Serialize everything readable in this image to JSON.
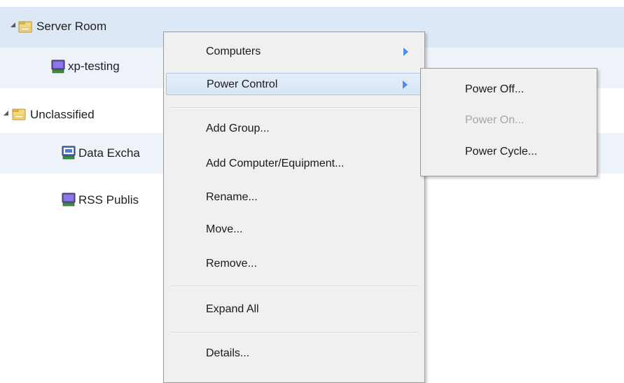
{
  "tree": {
    "nodes": [
      {
        "label": "Server Room",
        "icon": "folder-icon",
        "expanded": true
      },
      {
        "label": "xp-testing",
        "icon": "computer-icon"
      },
      {
        "label": "Unclassified",
        "icon": "folder-icon",
        "expanded": true
      },
      {
        "label": "Data Excha",
        "icon": "computer-icon"
      },
      {
        "label": "RSS Publis",
        "icon": "computer-icon"
      }
    ]
  },
  "context_menu": {
    "items": [
      {
        "label": "Computers",
        "has_submenu": true
      },
      {
        "label": "Power Control",
        "has_submenu": true,
        "highlighted": true
      },
      {
        "label": "Add Group..."
      },
      {
        "label": "Add Computer/Equipment..."
      },
      {
        "label": "Rename..."
      },
      {
        "label": "Move..."
      },
      {
        "label": "Remove..."
      },
      {
        "label": "Expand All"
      },
      {
        "label": "Details..."
      }
    ]
  },
  "power_submenu": {
    "items": [
      {
        "label": "Power Off...",
        "enabled": true
      },
      {
        "label": "Power On...",
        "enabled": false
      },
      {
        "label": "Power Cycle...",
        "enabled": true
      }
    ]
  },
  "colors": {
    "menu_background": "#f0f0f0",
    "highlight": "#d6e5f6",
    "submenu_arrow": "#4a8fe0",
    "disabled_text": "#a6a6a6",
    "row_highlight": "#dce8f5"
  }
}
